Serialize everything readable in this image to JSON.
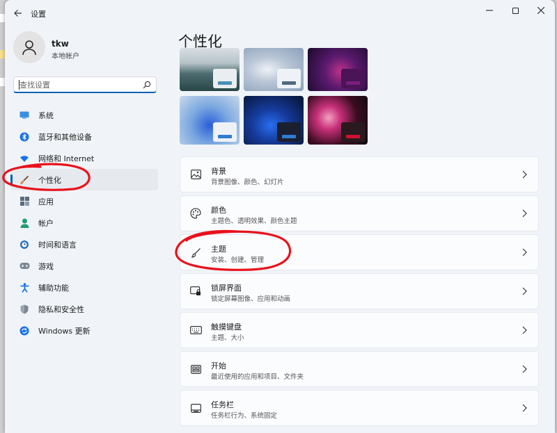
{
  "window": {
    "title": "设置"
  },
  "profile": {
    "name": "tkw",
    "subtitle": "本地帐户"
  },
  "search": {
    "placeholder": "查找设置"
  },
  "sidebar": {
    "items": [
      {
        "label": "系统",
        "icon": "system-icon"
      },
      {
        "label": "蓝牙和其他设备",
        "icon": "bluetooth-icon"
      },
      {
        "label": "网络和 Internet",
        "icon": "wifi-icon"
      },
      {
        "label": "个性化",
        "icon": "brush-icon"
      },
      {
        "label": "应用",
        "icon": "apps-icon"
      },
      {
        "label": "帐户",
        "icon": "person-icon"
      },
      {
        "label": "时间和语言",
        "icon": "globe-clock-icon"
      },
      {
        "label": "游戏",
        "icon": "gamepad-icon"
      },
      {
        "label": "辅助功能",
        "icon": "accessibility-icon"
      },
      {
        "label": "隐私和安全性",
        "icon": "shield-icon"
      },
      {
        "label": "Windows 更新",
        "icon": "update-icon"
      }
    ]
  },
  "main": {
    "title": "个性化",
    "cards": [
      {
        "title": "背景",
        "subtitle": "背景图像、颜色、幻灯片",
        "icon": "image-icon"
      },
      {
        "title": "颜色",
        "subtitle": "主题色、透明效果、颜色主题",
        "icon": "palette-icon"
      },
      {
        "title": "主题",
        "subtitle": "安装、创建、管理",
        "icon": "brush-icon"
      },
      {
        "title": "锁屏界面",
        "subtitle": "锁定屏幕图像、应用和动画",
        "icon": "lock-screen-icon"
      },
      {
        "title": "触摸键盘",
        "subtitle": "主题、大小",
        "icon": "keyboard-icon"
      },
      {
        "title": "开始",
        "subtitle": "最近使用的应用和项目、文件夹",
        "icon": "start-icon"
      },
      {
        "title": "任务栏",
        "subtitle": "任务栏行为、系统固定",
        "icon": "taskbar-icon"
      }
    ]
  },
  "colors": {
    "accent": "#005fb8",
    "annotation": "#e8121c"
  }
}
